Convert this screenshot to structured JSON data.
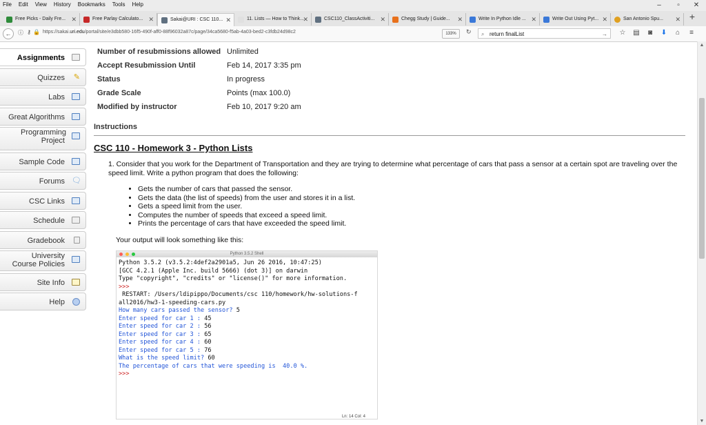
{
  "menubar": {
    "items": [
      "File",
      "Edit",
      "View",
      "History",
      "Bookmarks",
      "Tools",
      "Help"
    ],
    "window_controls": [
      "–",
      "▫",
      "✕"
    ]
  },
  "tabs": [
    {
      "label": "Free Picks - Daily Fre...",
      "icon_color": "#2e8b3a",
      "active": false
    },
    {
      "label": "Free Parlay Calculato...",
      "icon_color": "#c62828",
      "active": false
    },
    {
      "label": "Sakai@URI : CSC 110...",
      "icon_color": "#607080",
      "active": true
    },
    {
      "label": "11. Lists — How to Think...",
      "icon_color": "#e0e0e0",
      "active": false
    },
    {
      "label": "CSC110_ClassActiviti...",
      "icon_color": "#607080",
      "active": false
    },
    {
      "label": "Chegg Study | Guide...",
      "icon_color": "#e8711c",
      "active": false
    },
    {
      "label": "Write In Python Idle ...",
      "icon_color": "#3a78d8",
      "active": false
    },
    {
      "label": "Write Out Using Pyt...",
      "icon_color": "#3a78d8",
      "active": false
    },
    {
      "label": "San Antonio Spu...",
      "icon_color": "#e0a020",
      "active": false
    }
  ],
  "navbar": {
    "url_prefix": "https://sakai.",
    "url_domain": "uri.edu",
    "url_rest": "/portal/site/e3dbb580-16f5-490f-aff0-88f96032a87c/page/34ca5680-f5ab-4a03-bed2-c3fdb24d98c2",
    "zoom": "133%",
    "search_value": "return finalList"
  },
  "sidebar": {
    "items": [
      {
        "label": "Assignments",
        "icon": "assignments-icon",
        "active": true
      },
      {
        "label": "Quizzes",
        "icon": "pencil-icon",
        "active": false
      },
      {
        "label": "Labs",
        "icon": "book-icon",
        "active": false
      },
      {
        "label": "Great Algorithms",
        "icon": "book-icon",
        "active": false
      },
      {
        "label": "Programming Project",
        "icon": "book-icon",
        "active": false
      },
      {
        "label": "Sample Code",
        "icon": "book-icon",
        "active": false
      },
      {
        "label": "Forums",
        "icon": "forum-icon",
        "active": false
      },
      {
        "label": "CSC Links",
        "icon": "book-icon",
        "active": false
      },
      {
        "label": "Schedule",
        "icon": "calendar-icon",
        "active": false
      },
      {
        "label": "Gradebook",
        "icon": "gradebook-icon",
        "active": false
      },
      {
        "label": "University Course Policies",
        "icon": "book-icon",
        "active": false
      },
      {
        "label": "Site Info",
        "icon": "site-info-icon",
        "active": false
      },
      {
        "label": "Help",
        "icon": "help-icon",
        "active": false
      }
    ]
  },
  "properties": [
    {
      "label": "Number of resubmissions allowed",
      "value": "Unlimited"
    },
    {
      "label": "Accept Resubmission Until",
      "value": "Feb 14, 2017 3:35 pm"
    },
    {
      "label": "Status",
      "value": "In progress"
    },
    {
      "label": "Grade Scale",
      "value": "Points (max 100.0)"
    },
    {
      "label": "Modified by instructor",
      "value": "Feb 10, 2017 9:20 am"
    }
  ],
  "instructions": {
    "header": "Instructions",
    "title": "CSC 110 - Homework 3 - Python Lists",
    "question": "1. Consider that you work for the Department of Transportation and they are trying to determine what percentage of cars that pass a sensor at a certain spot are traveling over the speed limit.  Write a python program that does the following:",
    "bullets": [
      "Gets the number of cars that passed the sensor.",
      "Gets the data (the list of speeds) from the user and stores it in a list.",
      "Gets a speed limit from the user.",
      "Computes the number of speeds that exceed a speed limit.",
      "Prints the percentage of cars that have exceeded the speed limit."
    ],
    "output_intro": "Your output will look something like this:"
  },
  "shell": {
    "title": "Python 3.5.2 Shell",
    "lines": [
      {
        "text": "Python 3.5.2 (v3.5.2:4def2a2901a5, Jun 26 2016, 10:47:25)",
        "color": "black"
      },
      {
        "text": "[GCC 4.2.1 (Apple Inc. build 5666) (dot 3)] on darwin",
        "color": "black"
      },
      {
        "text": "Type \"copyright\", \"credits\" or \"license()\" for more information.",
        "color": "black"
      },
      {
        "text": ">>>",
        "color": "red"
      },
      {
        "text": " RESTART: /Users/ldipippo/Documents/csc 110/homework/hw-solutions-f",
        "color": "black"
      },
      {
        "text": "all2016/hw3-1-speeding-cars.py",
        "color": "black"
      },
      {
        "text": "How many cars passed the sensor? ",
        "color": "blue",
        "input": "5"
      },
      {
        "text": "Enter speed for car 1 : ",
        "color": "blue",
        "input": "45"
      },
      {
        "text": "Enter speed for car 2 : ",
        "color": "blue",
        "input": "56"
      },
      {
        "text": "Enter speed for car 3 : ",
        "color": "blue",
        "input": "65"
      },
      {
        "text": "Enter speed for car 4 : ",
        "color": "blue",
        "input": "60"
      },
      {
        "text": "Enter speed for car 5 : ",
        "color": "blue",
        "input": "76"
      },
      {
        "text": "What is the speed limit? ",
        "color": "blue",
        "input": "60"
      },
      {
        "text": "The percentage of cars that were speeding is  40.0 %.",
        "color": "blue"
      },
      {
        "text": ">>>",
        "color": "red"
      }
    ],
    "status": "Ln: 14  Col: 4"
  }
}
